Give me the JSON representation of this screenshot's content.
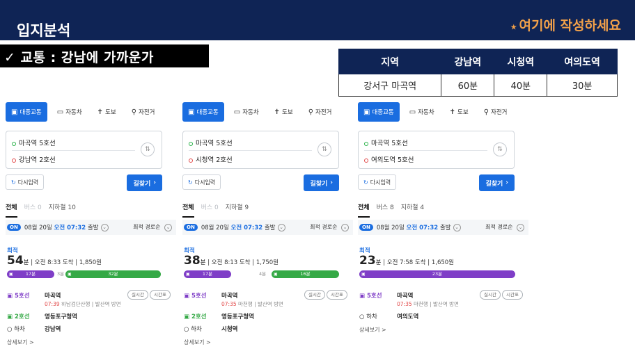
{
  "header": {
    "title": "입지분석",
    "note_star": "⭑",
    "note": "여기에 작성하세요"
  },
  "section": {
    "label": "✓ 교통 : 강남에 가까운가"
  },
  "summary_table": {
    "headers": [
      "지역",
      "강남역",
      "시청역",
      "여의도역"
    ],
    "row": [
      "강서구 마곡역",
      "60분",
      "40분",
      "30분"
    ]
  },
  "modes": [
    "대중교통",
    "자동차",
    "도보",
    "자전거"
  ],
  "common": {
    "reset_label": "다시입력",
    "search_label": "길찾기",
    "tab_all": "전체",
    "on_badge": "ON",
    "depart_date": "08월 20일",
    "depart_time": "오전 07:32",
    "depart_suffix": "출발",
    "sort_label": "최적 경로순",
    "best_label": "최적",
    "more_label": "상세보기 >",
    "realtime_label": "실시간",
    "timetable_label": "시간표",
    "alight_label": "하차",
    "line5": "5호선",
    "line2": "2호선",
    "start_station": "마곡역"
  },
  "panels": [
    {
      "origin": "마곡역 5호선",
      "destination": "강남역 2호선",
      "tab_bus": "버스 0",
      "tab_subway": "지하철 10",
      "duration_num": "54",
      "duration_unit": "분",
      "arrive": "오전 8:33 도착",
      "fare": "1,850원",
      "seg1_label": "17분",
      "walk_label": "3분",
      "seg2_label": "32분",
      "detail_time": "07:39",
      "detail_rest": "하남검단산행 | 발산역 방면",
      "transfer_station": "영등포구청역",
      "final_station": "강남역"
    },
    {
      "origin": "마곡역 5호선",
      "destination": "시청역 2호선",
      "tab_bus": "버스 0",
      "tab_subway": "지하철 9",
      "duration_num": "38",
      "duration_unit": "분",
      "arrive": "오전 8:13 도착",
      "fare": "1,750원",
      "seg1_label": "17분",
      "walk_label": "4분",
      "seg2_label": "16분",
      "detail_time": "07:35",
      "detail_rest": "마천행 | 발산역 방면",
      "transfer_station": "영등포구청역",
      "final_station": "시청역"
    },
    {
      "origin": "마곡역 5호선",
      "destination": "여의도역 5호선",
      "tab_bus": "버스 8",
      "tab_subway": "지하철 4",
      "duration_num": "23",
      "duration_unit": "분",
      "arrive": "오전 7:58 도착",
      "fare": "1,650원",
      "seg1_label": "23분",
      "detail_time": "07:35",
      "detail_rest": "마천행 | 발산역 방면",
      "final_station": "여의도역"
    }
  ],
  "colors": {
    "navy": "#0f2455",
    "accent_orange": "#f2a14a",
    "blue": "#1a6de0",
    "line5_purple": "#7f3ec7",
    "line2_green": "#35a946"
  },
  "icons": {
    "transit": "bus-icon",
    "car": "car-icon",
    "walk": "walk-icon",
    "bike": "bicycle-icon",
    "swap": "swap-icon",
    "reset": "refresh-icon"
  }
}
